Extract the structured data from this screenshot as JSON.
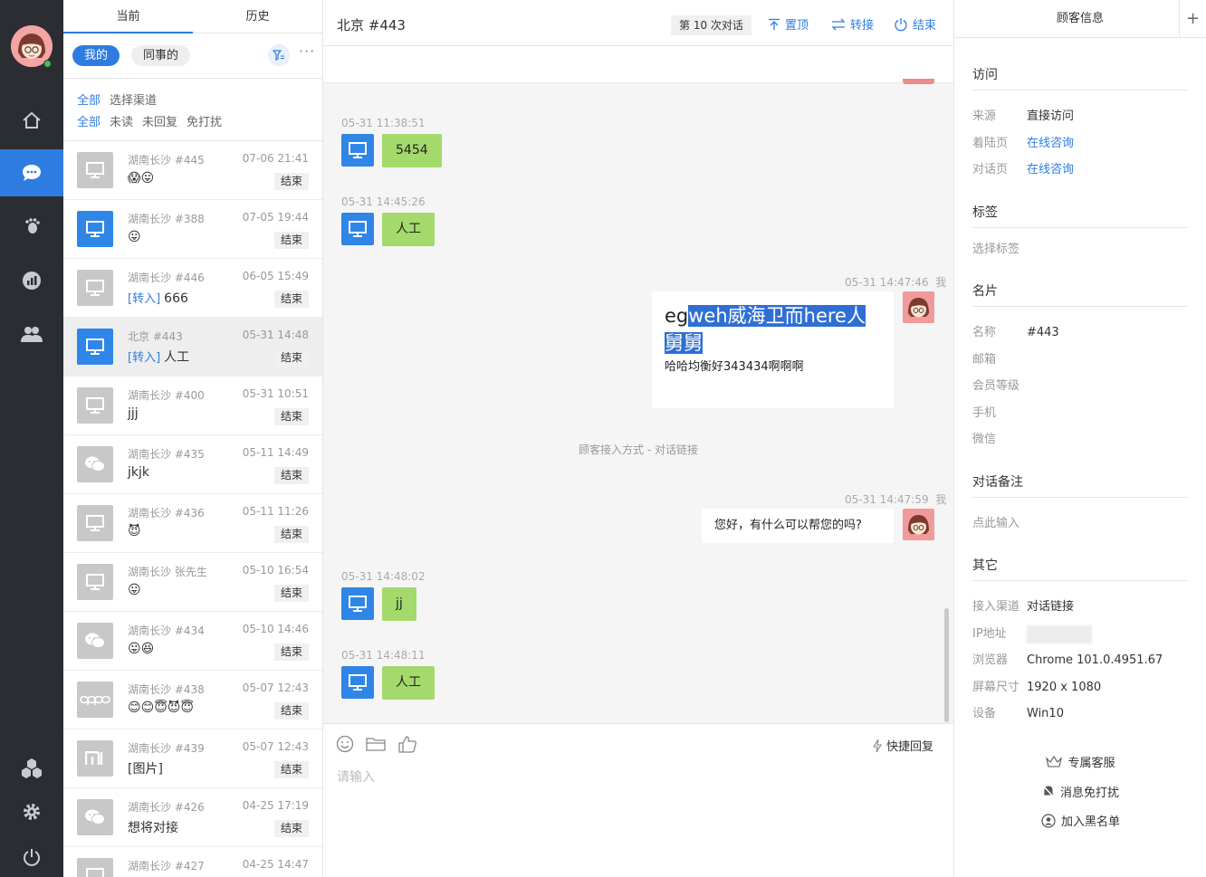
{
  "list": {
    "tabs": [
      "当前",
      "历史"
    ],
    "scope": {
      "mine": "我的",
      "colleague": "同事的",
      "more": "···"
    },
    "filter_row1": [
      "全部",
      "选择渠道"
    ],
    "filter_row2": [
      "全部",
      "未读",
      "未回复",
      "免打扰"
    ],
    "items": [
      {
        "name": "湖南长沙 #445",
        "time": "07-06 21:41",
        "msg": "😱😛",
        "tag": "",
        "icon": "monitor-icon",
        "color": "gray",
        "end": "结束"
      },
      {
        "name": "湖南长沙 #388",
        "time": "07-05 19:44",
        "msg": "😛",
        "tag": "",
        "icon": "monitor-icon",
        "color": "blue",
        "end": "结束"
      },
      {
        "name": "湖南长沙 #446",
        "time": "06-05 15:49",
        "msg": "666",
        "tag": "[转入]",
        "icon": "monitor-icon",
        "color": "gray",
        "end": "结束"
      },
      {
        "name": "北京 #443",
        "time": "05-31 14:48",
        "msg": "人工",
        "tag": "[转入]",
        "icon": "monitor-icon",
        "color": "blue",
        "end": "结束"
      },
      {
        "name": "湖南长沙 #400",
        "time": "05-31 10:51",
        "msg": "jjj",
        "tag": "",
        "icon": "monitor-icon",
        "color": "gray",
        "end": "结束"
      },
      {
        "name": "湖南长沙 #435",
        "time": "05-11 14:49",
        "msg": "jkjk",
        "tag": "",
        "icon": "wechat-icon",
        "color": "gray",
        "end": "结束"
      },
      {
        "name": "湖南长沙 #436",
        "time": "05-11 11:26",
        "msg": "😈",
        "tag": "",
        "icon": "monitor-icon",
        "color": "gray",
        "end": "结束"
      },
      {
        "name": "湖南长沙 张先生",
        "time": "05-10 16:54",
        "msg": "😛",
        "tag": "",
        "icon": "monitor-icon",
        "color": "gray",
        "end": "结束"
      },
      {
        "name": "湖南长沙 #434",
        "time": "05-10 14:46",
        "msg": "😛😆",
        "tag": "",
        "icon": "wechat-icon",
        "color": "gray",
        "end": "结束"
      },
      {
        "name": "湖南长沙 #438",
        "time": "05-07 12:43",
        "msg": "😊😊😇😈😇",
        "tag": "",
        "icon": "oppo-icon",
        "color": "gray",
        "end": "结束"
      },
      {
        "name": "湖南长沙 #439",
        "time": "05-07 12:43",
        "msg": "[图片]",
        "tag": "",
        "icon": "mi-icon",
        "color": "gray",
        "end": "结束"
      },
      {
        "name": "湖南长沙 #426",
        "time": "04-25 17:19",
        "msg": "想将对接",
        "tag": "",
        "icon": "wechat-icon",
        "color": "gray",
        "end": "结束"
      },
      {
        "name": "湖南长沙 #427",
        "time": "04-25 14:47",
        "msg": "",
        "tag": "",
        "icon": "monitor-icon",
        "color": "gray",
        "end": ""
      }
    ]
  },
  "chat": {
    "title": "北京 #443",
    "count": "第 10 次对话",
    "actions": {
      "pin": "置顶",
      "transfer": "转接",
      "end": "结束"
    },
    "messages": [
      {
        "time": "05-31 11:38:51",
        "text": "5454"
      },
      {
        "time": "05-31 14:45:26",
        "text": "人工"
      },
      {
        "time": "05-31 14:47:46",
        "me": "我",
        "line1_pre": "eg",
        "line1_hl": "weh威海卫而here人",
        "line2_hl": "舅舅",
        "line3": "哈哈均衡好343434啊啊啊"
      },
      {
        "system": "顾客接入方式 - 对话链接"
      },
      {
        "time": "05-31 14:47:59",
        "me": "我",
        "text": "您好，有什么可以帮您的吗?"
      },
      {
        "time": "05-31 14:48:02",
        "text": "jj"
      },
      {
        "time": "05-31 14:48:11",
        "text": "人工"
      }
    ],
    "composer": {
      "quick_reply": "快捷回复",
      "placeholder": "请输入"
    }
  },
  "side": {
    "title": "顾客信息",
    "plus": "+",
    "visit": {
      "title": "访问",
      "source_k": "来源",
      "source_v": "直接访问",
      "landing_k": "着陆页",
      "landing_v": "在线咨询",
      "dialog_k": "对话页",
      "dialog_v": "在线咨询"
    },
    "tags": {
      "title": "标签",
      "placeholder": "选择标签"
    },
    "card": {
      "title": "名片",
      "name_k": "名称",
      "name_v": "#443",
      "email_k": "邮箱",
      "level_k": "会员等级",
      "phone_k": "手机",
      "wechat_k": "微信"
    },
    "note": {
      "title": "对话备注",
      "placeholder": "点此输入"
    },
    "other": {
      "title": "其它",
      "channel_k": "接入渠道",
      "channel_v": "对话链接",
      "ip_k": "IP地址",
      "browser_k": "浏览器",
      "browser_v": "Chrome 101.0.4951.67",
      "screen_k": "屏幕尺寸",
      "screen_v": "1920 x 1080",
      "device_k": "设备",
      "device_v": "Win10"
    },
    "actions": {
      "exclusive": "专属客服",
      "mute": "消息免打扰",
      "blacklist": "加入黑名单"
    }
  },
  "colors": {
    "accent": "#2f7ce0",
    "rail": "#2b2d33",
    "bubble_green": "#a4d96c"
  }
}
